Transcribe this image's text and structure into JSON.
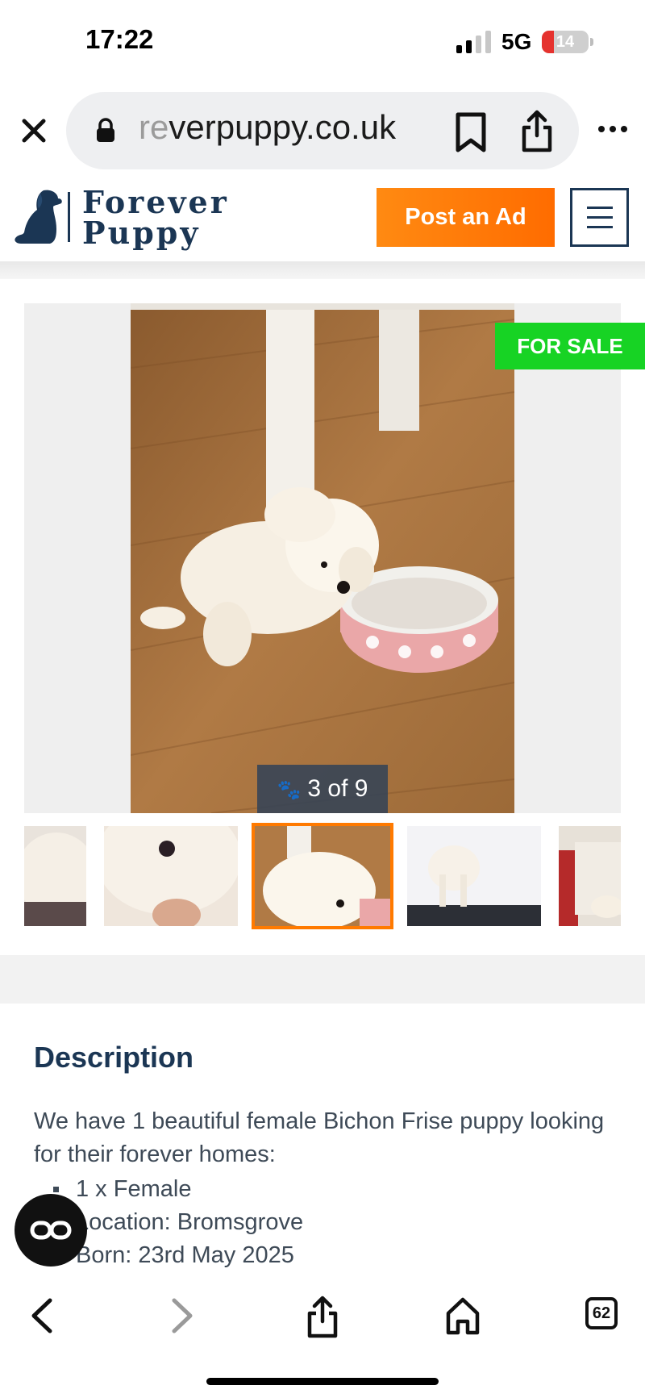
{
  "status_bar": {
    "time": "17:22",
    "network": "5G",
    "battery": "14"
  },
  "browser": {
    "url_faded": "re",
    "url_main": "verpuppy.co.uk",
    "tabs_count": "62"
  },
  "site": {
    "logo_line1": "Forever",
    "logo_line2": "Puppy",
    "post_ad_label": "Post an Ad"
  },
  "gallery": {
    "badge": "FOR SALE",
    "counter": "3 of 9",
    "current_index": 3,
    "total": 9
  },
  "description": {
    "title": "Description",
    "intro": "We have 1 beautiful female Bichon Frise puppy looking for their forever homes:",
    "items": [
      "1 x Female",
      "Location: Bromsgrove",
      "Born: 23rd May 2025"
    ]
  },
  "colors": {
    "brand_navy": "#1b3654",
    "accent_orange": "#ff7a00",
    "for_sale_green": "#17d324"
  }
}
